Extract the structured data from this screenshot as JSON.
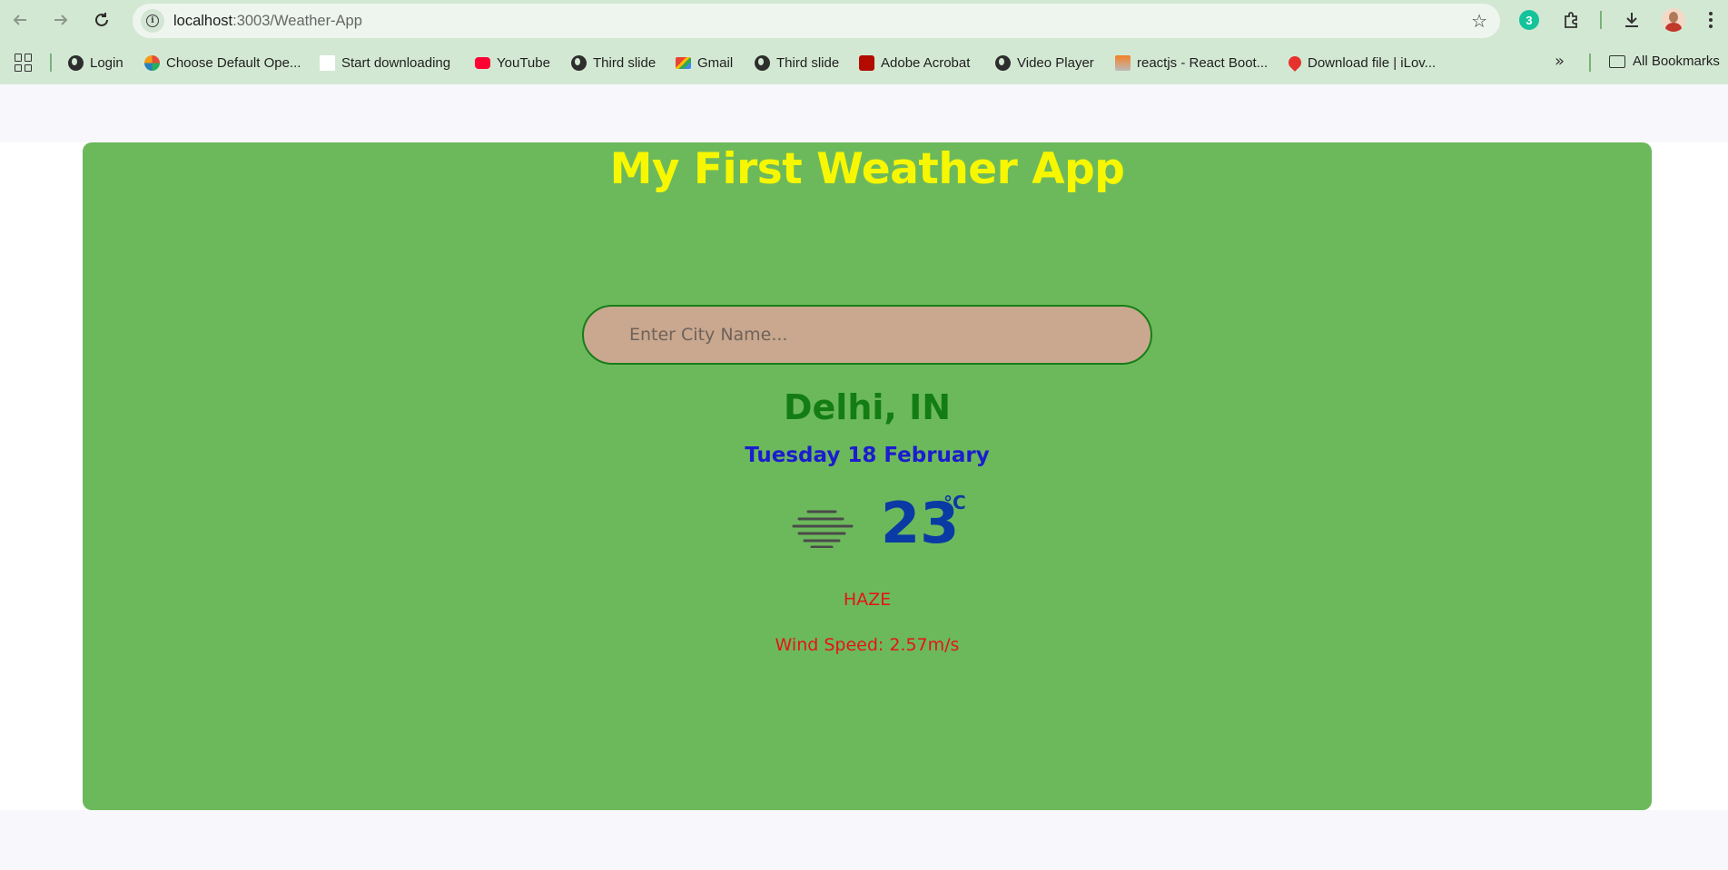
{
  "browser": {
    "url_host": "localhost",
    "url_rest": ":3003/Weather-App",
    "extension_badge": "3",
    "bookmarks": [
      {
        "label": "Login",
        "icon": "globe-icon"
      },
      {
        "label": "Choose Default Ope...",
        "icon": "office-icon"
      },
      {
        "label": "Start downloading",
        "icon": "blank-page-icon"
      },
      {
        "label": "YouTube",
        "icon": "youtube-icon"
      },
      {
        "label": "Third slide",
        "icon": "globe-icon"
      },
      {
        "label": "Gmail",
        "icon": "gmail-icon"
      },
      {
        "label": "Third slide",
        "icon": "globe-icon"
      },
      {
        "label": "Adobe Acrobat",
        "icon": "acrobat-icon"
      },
      {
        "label": "Video Player",
        "icon": "globe-icon"
      },
      {
        "label": "reactjs - React Boot...",
        "icon": "stackoverflow-icon"
      },
      {
        "label": "Download file | iLov...",
        "icon": "heart-icon"
      }
    ],
    "overflow_label": "»",
    "all_bookmarks_label": "All Bookmarks"
  },
  "app": {
    "title": "My First Weather App",
    "search_placeholder": "Enter City Name...",
    "city": "Delhi, IN",
    "date": "Tuesday 18 February",
    "temperature": "23",
    "unit": "°C",
    "condition_icon": "haze-icon",
    "description": "HAZE",
    "wind": "Wind Speed: 2.57m/s"
  },
  "colors": {
    "card_bg": "#6cb95c",
    "title": "#f7f701",
    "city": "#137d13",
    "date": "#1b1ccf",
    "temperature": "#0a3aa4",
    "details": "#e51414",
    "search_bg": "#c9a88f",
    "search_border": "#177e17"
  }
}
